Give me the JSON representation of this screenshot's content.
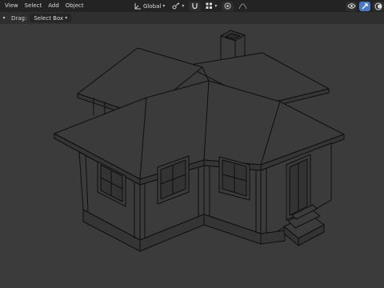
{
  "header": {
    "menu": [
      "View",
      "Select",
      "Add",
      "Object"
    ],
    "orientation_label": "Global"
  },
  "toolbar": {
    "drag_label": "Drag:",
    "select_mode": "Select Box"
  },
  "icons": {
    "transform_orientation": "axes-icon",
    "pivot": "pivot-icon",
    "snap": "magnet-icon",
    "snap_target": "grid-snap-icon",
    "proportional_edit": "proportional-edit-icon",
    "falloff": "falloff-curve-icon",
    "visibility": "eye-icon",
    "gizmo": "gizmo-icon",
    "overlay": "overlay-icon"
  },
  "colors": {
    "header_bg": "#232323",
    "viewport_bg": "#3b3b3b",
    "accent": "#4a79c4",
    "wire": "#0e0e0e"
  }
}
